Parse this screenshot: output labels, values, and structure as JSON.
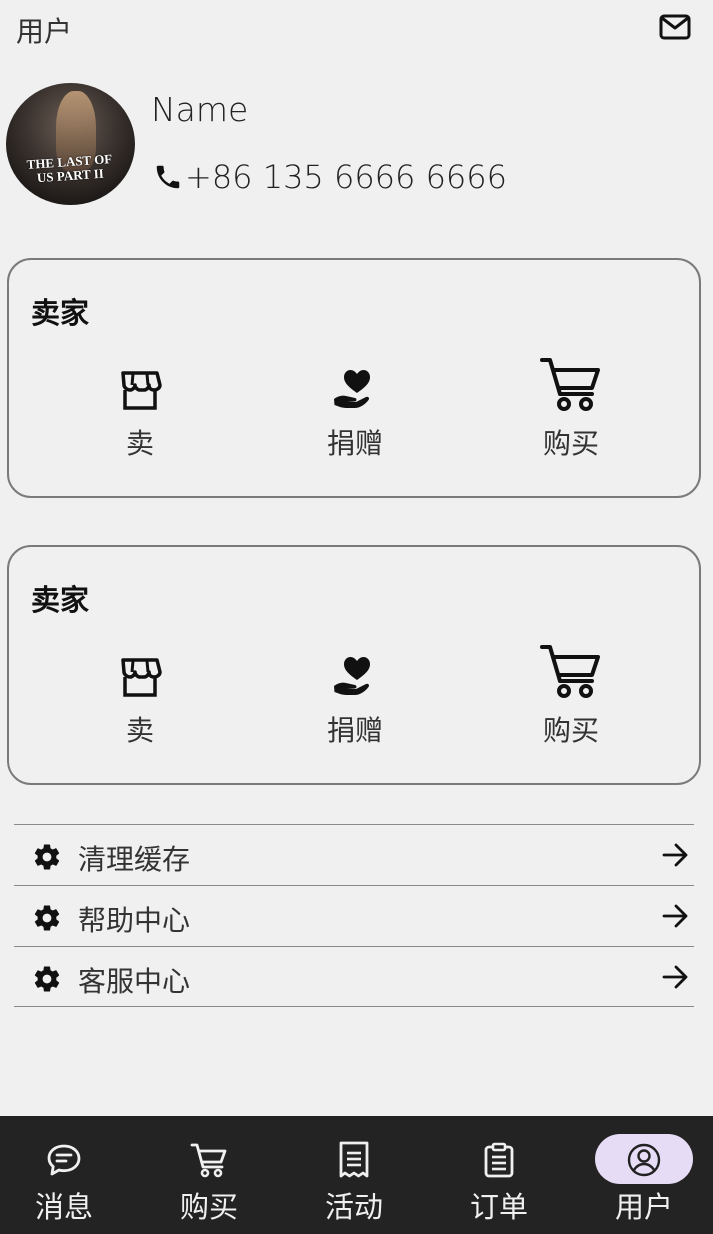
{
  "header": {
    "title": "用户",
    "mail_icon": "mail-icon"
  },
  "profile": {
    "avatar_text": "THE LAST OF US PART II",
    "name": "Name",
    "phone": "+86 135 6666 6666",
    "phone_icon": "phone-icon"
  },
  "cards": [
    {
      "title": "卖家",
      "actions": [
        {
          "label": "卖",
          "icon": "store-icon"
        },
        {
          "label": "捐赠",
          "icon": "heart-hand-icon"
        },
        {
          "label": "购买",
          "icon": "cart-icon"
        }
      ]
    },
    {
      "title": "卖家",
      "actions": [
        {
          "label": "卖",
          "icon": "store-icon"
        },
        {
          "label": "捐赠",
          "icon": "heart-hand-icon"
        },
        {
          "label": "购买",
          "icon": "cart-icon"
        }
      ]
    }
  ],
  "menu": [
    {
      "label": "清理缓存",
      "icon": "gear-icon"
    },
    {
      "label": "帮助中心",
      "icon": "gear-icon"
    },
    {
      "label": "客服中心",
      "icon": "gear-icon"
    }
  ],
  "tabs": [
    {
      "label": "消息",
      "icon": "chat-icon"
    },
    {
      "label": "购买",
      "icon": "cart-icon"
    },
    {
      "label": "活动",
      "icon": "receipt-icon"
    },
    {
      "label": "订单",
      "icon": "clipboard-icon"
    },
    {
      "label": "用户",
      "icon": "user-icon",
      "active": true
    }
  ],
  "colors": {
    "background": "#f0f0f0",
    "tabbar": "#232323",
    "active_pill": "#e6dcf6",
    "card_border": "#7a7a7a"
  }
}
